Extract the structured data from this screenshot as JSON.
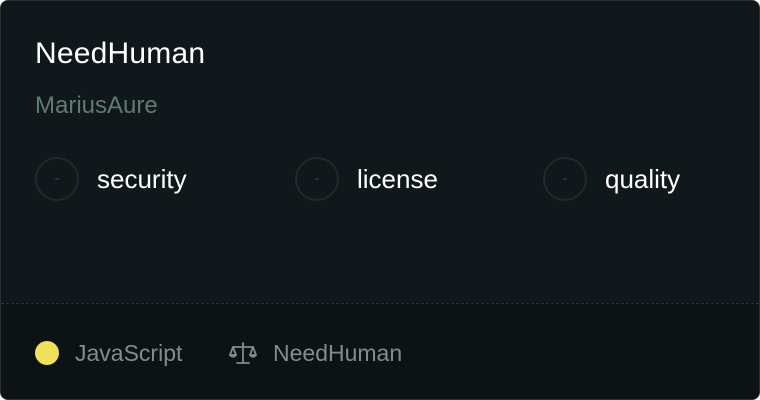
{
  "repo": {
    "name": "NeedHuman",
    "owner": "MariusAure"
  },
  "metrics": [
    {
      "label": "security",
      "score": "-"
    },
    {
      "label": "license",
      "score": "-"
    },
    {
      "label": "quality",
      "score": "-"
    }
  ],
  "footer": {
    "language": "JavaScript",
    "language_color": "#f1e05a",
    "license_icon": "scale-icon",
    "license": "NeedHuman"
  }
}
